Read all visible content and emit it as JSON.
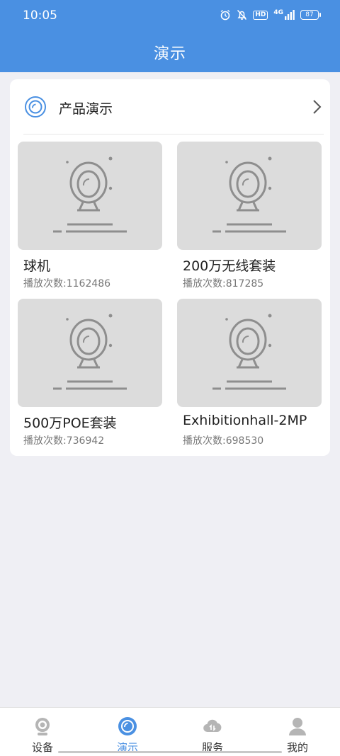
{
  "status_bar": {
    "time": "10:05",
    "network": "4G",
    "hd": "HD",
    "battery": "87"
  },
  "header": {
    "title": "演示"
  },
  "section": {
    "label": "产品演示"
  },
  "tiles": [
    {
      "title": "球机",
      "plays": "播放次数:1162486"
    },
    {
      "title": "200万无线套装",
      "plays": "播放次数:817285"
    },
    {
      "title": "500万POE套装",
      "plays": "播放次数:736942"
    },
    {
      "title": "Exhibitionhall-2MP",
      "plays": "播放次数:698530"
    }
  ],
  "tabs": [
    {
      "label": "设备",
      "icon": "camera-icon"
    },
    {
      "label": "演示",
      "icon": "demo-icon"
    },
    {
      "label": "服务",
      "icon": "cloud-icon"
    },
    {
      "label": "我的",
      "icon": "user-icon"
    }
  ],
  "colors": {
    "primary": "#4a90e2",
    "background": "#efeff4",
    "placeholder": "#dcdcdc"
  }
}
